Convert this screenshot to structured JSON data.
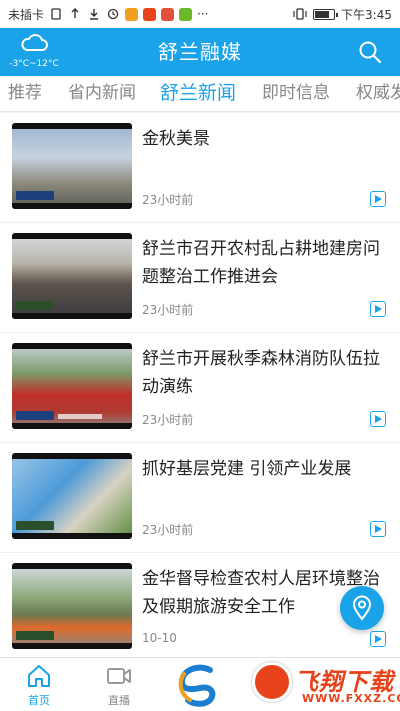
{
  "status_bar": {
    "carrier": "未插卡",
    "time": "下午3:45",
    "more": "···"
  },
  "header": {
    "title": "舒兰融媒",
    "weather_temp": "-3°C~12°C",
    "weather_icon": "cloud-icon",
    "search_icon": "search-icon"
  },
  "tabs": [
    {
      "label": "推荐"
    },
    {
      "label": "省内新闻"
    },
    {
      "label": "舒兰新闻"
    },
    {
      "label": "即时信息"
    },
    {
      "label": "权威发"
    }
  ],
  "active_tab": "舒兰新闻",
  "news": [
    {
      "title": "金秋美景",
      "time": "23小时前"
    },
    {
      "title": "舒兰市召开农村乱占耕地建房问题整治工作推进会",
      "time": "23小时前"
    },
    {
      "title": "舒兰市开展秋季森林消防队伍拉动演练",
      "time": "23小时前"
    },
    {
      "title": "抓好基层党建 引领产业发展",
      "time": "23小时前"
    },
    {
      "title": "金华督导检查农村人居环境整治及假期旅游安全工作",
      "time": "10-10"
    }
  ],
  "bottom_nav": [
    {
      "label": "首页",
      "icon": "home-icon"
    },
    {
      "label": "直播",
      "icon": "video-icon"
    }
  ],
  "watermark": {
    "text": "飞翔下载",
    "url": "WWW.FXXZ.COM"
  },
  "colors": {
    "accent": "#1aa3e8",
    "watermark": "#e8421a"
  }
}
